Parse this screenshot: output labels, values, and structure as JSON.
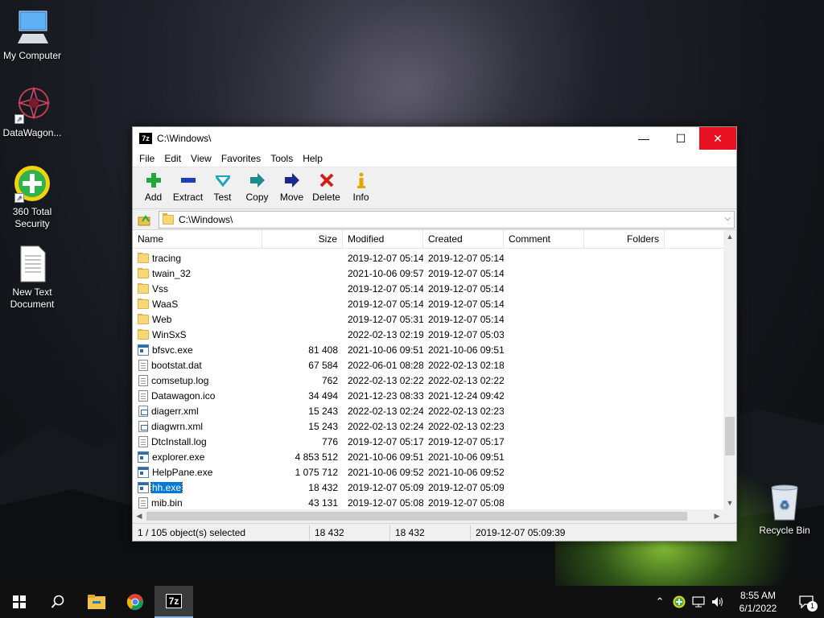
{
  "desktop": {
    "icons": [
      {
        "label": "My Computer"
      },
      {
        "label": "DataWagon..."
      },
      {
        "label": "360 Total Security"
      },
      {
        "label": "New Text Document"
      },
      {
        "label": "Recycle Bin"
      }
    ]
  },
  "window": {
    "title": "C:\\Windows\\",
    "app_icon_text": "7z",
    "controls": {
      "minimize": "—",
      "maximize": "☐",
      "close": "✕"
    }
  },
  "menu": [
    "File",
    "Edit",
    "View",
    "Favorites",
    "Tools",
    "Help"
  ],
  "toolbar": [
    {
      "label": "Add",
      "icon": "add-icon"
    },
    {
      "label": "Extract",
      "icon": "extract-icon"
    },
    {
      "label": "Test",
      "icon": "test-icon"
    },
    {
      "label": "Copy",
      "icon": "copy-icon"
    },
    {
      "label": "Move",
      "icon": "move-icon"
    },
    {
      "label": "Delete",
      "icon": "delete-icon"
    },
    {
      "label": "Info",
      "icon": "info-icon"
    }
  ],
  "address": {
    "value": "C:\\Windows\\"
  },
  "columns": [
    "Name",
    "Size",
    "Modified",
    "Created",
    "Comment",
    "Folders"
  ],
  "files": [
    {
      "name": "tracing",
      "type": "folder",
      "size": "",
      "modified": "2019-12-07 05:14",
      "created": "2019-12-07 05:14"
    },
    {
      "name": "twain_32",
      "type": "folder",
      "size": "",
      "modified": "2021-10-06 09:57",
      "created": "2019-12-07 05:14"
    },
    {
      "name": "Vss",
      "type": "folder",
      "size": "",
      "modified": "2019-12-07 05:14",
      "created": "2019-12-07 05:14"
    },
    {
      "name": "WaaS",
      "type": "folder",
      "size": "",
      "modified": "2019-12-07 05:14",
      "created": "2019-12-07 05:14"
    },
    {
      "name": "Web",
      "type": "folder",
      "size": "",
      "modified": "2019-12-07 05:31",
      "created": "2019-12-07 05:14"
    },
    {
      "name": "WinSxS",
      "type": "folder",
      "size": "",
      "modified": "2022-02-13 02:19",
      "created": "2019-12-07 05:03"
    },
    {
      "name": "bfsvc.exe",
      "type": "exe",
      "size": "81 408",
      "modified": "2021-10-06 09:51",
      "created": "2021-10-06 09:51"
    },
    {
      "name": "bootstat.dat",
      "type": "doc",
      "size": "67 584",
      "modified": "2022-06-01 08:28",
      "created": "2022-02-13 02:18"
    },
    {
      "name": "comsetup.log",
      "type": "doc",
      "size": "762",
      "modified": "2022-02-13 02:22",
      "created": "2022-02-13 02:22"
    },
    {
      "name": "Datawagon.ico",
      "type": "doc",
      "size": "34 494",
      "modified": "2021-12-23 08:33",
      "created": "2021-12-24 09:42"
    },
    {
      "name": "diagerr.xml",
      "type": "xml",
      "size": "15 243",
      "modified": "2022-02-13 02:24",
      "created": "2022-02-13 02:23"
    },
    {
      "name": "diagwrn.xml",
      "type": "xml",
      "size": "15 243",
      "modified": "2022-02-13 02:24",
      "created": "2022-02-13 02:23"
    },
    {
      "name": "DtcInstall.log",
      "type": "doc",
      "size": "776",
      "modified": "2019-12-07 05:17",
      "created": "2019-12-07 05:17"
    },
    {
      "name": "explorer.exe",
      "type": "exe",
      "size": "4 853 512",
      "modified": "2021-10-06 09:51",
      "created": "2021-10-06 09:51"
    },
    {
      "name": "HelpPane.exe",
      "type": "exe",
      "size": "1 075 712",
      "modified": "2021-10-06 09:52",
      "created": "2021-10-06 09:52"
    },
    {
      "name": "hh.exe",
      "type": "exe",
      "size": "18 432",
      "modified": "2019-12-07 05:09",
      "created": "2019-12-07 05:09",
      "selected": true
    },
    {
      "name": "mib.bin",
      "type": "doc",
      "size": "43 131",
      "modified": "2019-12-07 05:08",
      "created": "2019-12-07 05:08"
    }
  ],
  "status": {
    "selection": "1 / 105 object(s) selected",
    "size": "18 432",
    "packed": "18 432",
    "date": "2019-12-07 05:09:39"
  },
  "taskbar": {
    "clock_time": "8:55 AM",
    "clock_date": "6/1/2022",
    "notification_count": "1"
  }
}
